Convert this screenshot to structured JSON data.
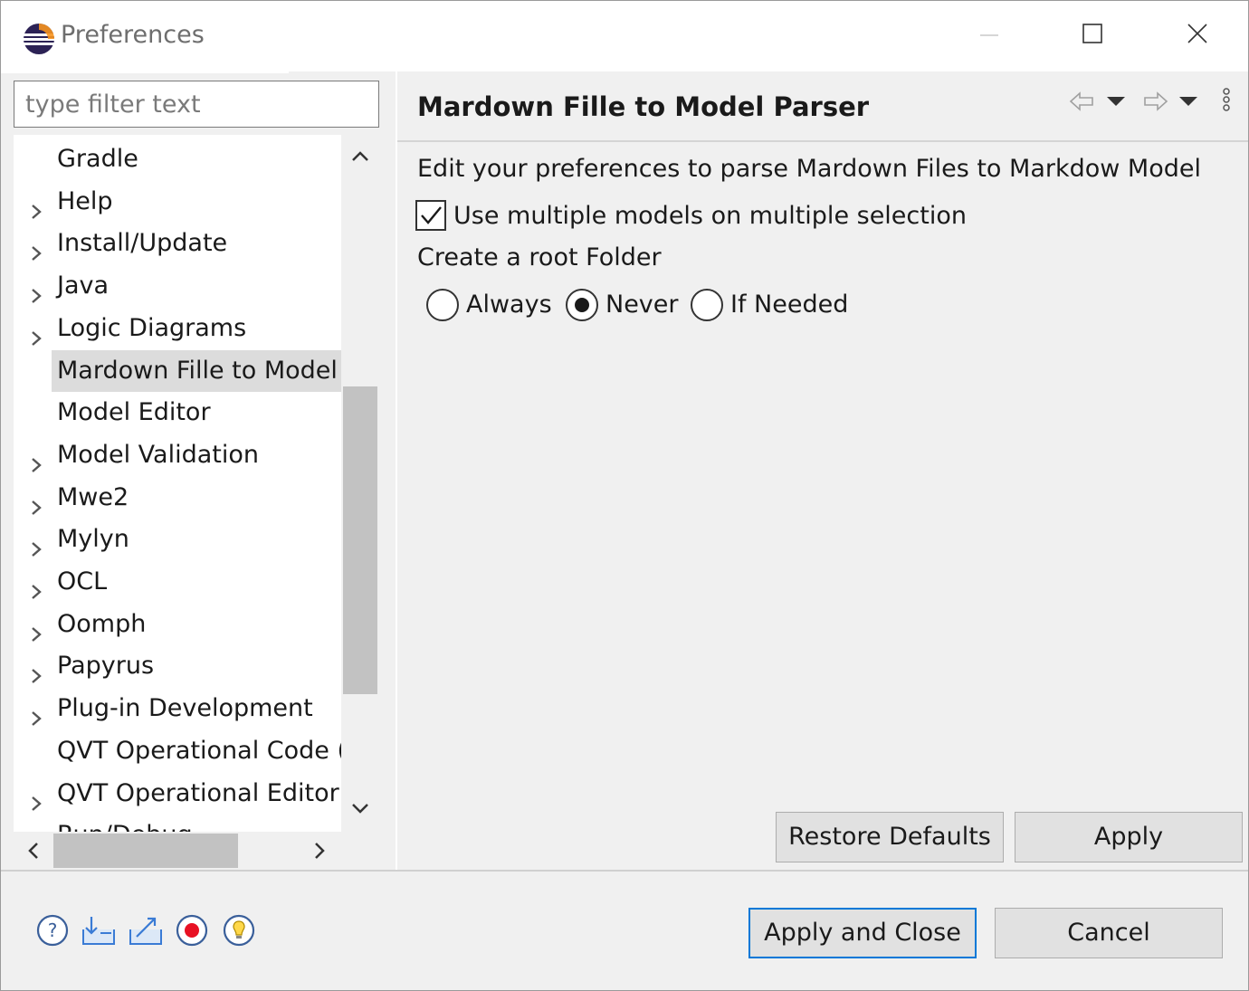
{
  "window": {
    "title": "Preferences",
    "icons": {
      "app": "eclipse-icon",
      "minimize": "minimize-icon",
      "maximize": "maximize-icon",
      "close": "close-icon"
    }
  },
  "filter": {
    "placeholder": "type filter text",
    "value": ""
  },
  "tree": {
    "items": [
      {
        "label": "Gradle",
        "expandable": false
      },
      {
        "label": "Help",
        "expandable": true
      },
      {
        "label": "Install/Update",
        "expandable": true
      },
      {
        "label": "Java",
        "expandable": true
      },
      {
        "label": "Logic Diagrams",
        "expandable": true
      },
      {
        "label": "Mardown Fille to Model",
        "expandable": false,
        "selected": true
      },
      {
        "label": "Model Editor",
        "expandable": false
      },
      {
        "label": "Model Validation",
        "expandable": true
      },
      {
        "label": "Mwe2",
        "expandable": true
      },
      {
        "label": "Mylyn",
        "expandable": true
      },
      {
        "label": "OCL",
        "expandable": true
      },
      {
        "label": "Oomph",
        "expandable": true
      },
      {
        "label": "Papyrus",
        "expandable": true
      },
      {
        "label": "Plug-in Development",
        "expandable": true
      },
      {
        "label": "QVT Operational Code (",
        "expandable": false
      },
      {
        "label": "QVT Operational Editor",
        "expandable": true
      },
      {
        "label": "Run/Debug",
        "expandable": true
      }
    ]
  },
  "page": {
    "title": "Mardown Fille to Model Parser",
    "description": "Edit your preferences to parse Mardown Files to Markdow Model",
    "checkbox": {
      "label": "Use multiple models on multiple selection",
      "checked": true
    },
    "root_folder_label": "Create a root Folder",
    "radio_options": [
      {
        "label": "Always",
        "selected": false
      },
      {
        "label": "Never",
        "selected": true
      },
      {
        "label": "If Needed",
        "selected": false
      }
    ],
    "restore_defaults_label": "Restore Defaults",
    "apply_label": "Apply",
    "nav_icons": [
      "back-arrow-icon",
      "dropdown-icon",
      "forward-arrow-icon",
      "dropdown-icon",
      "more-vertical-icon"
    ]
  },
  "footer": {
    "icons": [
      "help-icon",
      "import-icon",
      "export-icon",
      "record-icon",
      "lightbulb-icon"
    ],
    "apply_close_label": "Apply and Close",
    "cancel_label": "Cancel"
  },
  "colors": {
    "focus_border": "#0078d7",
    "record_red": "#e81123",
    "icon_blue": "#3a7bd5",
    "selection_bg": "#dcdcdc"
  }
}
